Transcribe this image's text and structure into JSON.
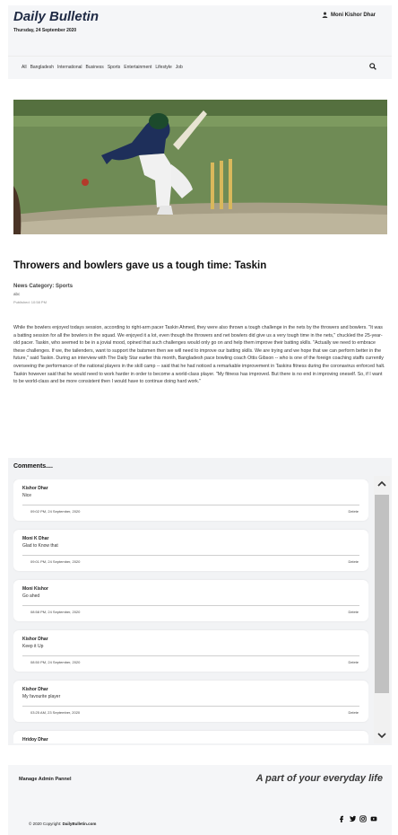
{
  "header": {
    "brand": "Daily Bulletin",
    "date": "Thursday, 24 September 2020",
    "user_name": "Moni Kishor Dhar"
  },
  "nav": {
    "items": [
      "All",
      "Bangladesh",
      "International",
      "Business",
      "Sports",
      "Entertainment",
      "Lifestyle",
      "Job"
    ]
  },
  "article": {
    "title": "Throwers and bowlers gave us a tough time: Taskin",
    "category_label": "News Category:",
    "category_value": "Sports",
    "author": "abc",
    "published": "Published: 10:58 PM",
    "body": "While the bowlers enjoyed todays session, according to right-arm pacer Taskin Ahmed, they were also thrown a tough challenge in the nets by the throwers and bowlers. \"It was a batting session for all the bowlers in the squad. We enjoyed it a lot, even though the throwers and net bowlers did give us a very tough time in the nets,\" chuckled the 25-year-old pacer. Taskin, who seemed to be in a jovial mood, opined that such challenges would only go on and help them improve their batting skills. \"Actually we need to embrace these challenges. If we, the tailenders, want to support the batsmen then we will need to improve our batting skills. We are trying and we hope that we can perform better in the future,\" said Taskin. During an interview with The Daily Star earlier this month, Bangladesh pace bowling coach Ottis Gibson -- who is one of the foreign coaching staffs currently overseeing the performance of the national players in the skill camp -- said that he had noticed a remarkable improvement in Taskins fitness during the coronavirus enforced halt. Taskin however said that he would need to work harder in order to become a world-class player. \"My fitness has improved. But there is no end in improving oneself. So, if I want to be world-class and be more consistent then I would have to continue doing hard work.\""
  },
  "comments": {
    "title": "Comments....",
    "delete_label": "Delete",
    "items": [
      {
        "name": "Kishor Dhar",
        "text": "Nice",
        "time": "09:02 PM, 24 September, 2020"
      },
      {
        "name": "Moni K Dhar",
        "text": "Glad to Know that",
        "time": "09:01 PM, 24 September, 2020"
      },
      {
        "name": "Moni Kishor",
        "text": "Go ahed",
        "time": "08:58 PM, 24 September, 2020"
      },
      {
        "name": "Kishor Dhar",
        "text": "Keep it Up",
        "time": "08:50 PM, 24 September, 2020"
      },
      {
        "name": "Kishor Dhar",
        "text": "My favourite player",
        "time": "03:25 AM, 23 September, 2020"
      },
      {
        "name": "Hridoy Dhar",
        "text": "",
        "time": ""
      }
    ]
  },
  "footer": {
    "admin_link": "Manage Admin Pannel",
    "tagline": "A part of your everyday life",
    "copyright_prefix": "© 2020 Copyright:",
    "copyright_site": "DailyBulletin.com"
  },
  "icons": {
    "user": "user-icon",
    "search": "search-icon",
    "social": [
      "facebook-icon",
      "twitter-icon",
      "instagram-icon",
      "youtube-icon"
    ]
  }
}
